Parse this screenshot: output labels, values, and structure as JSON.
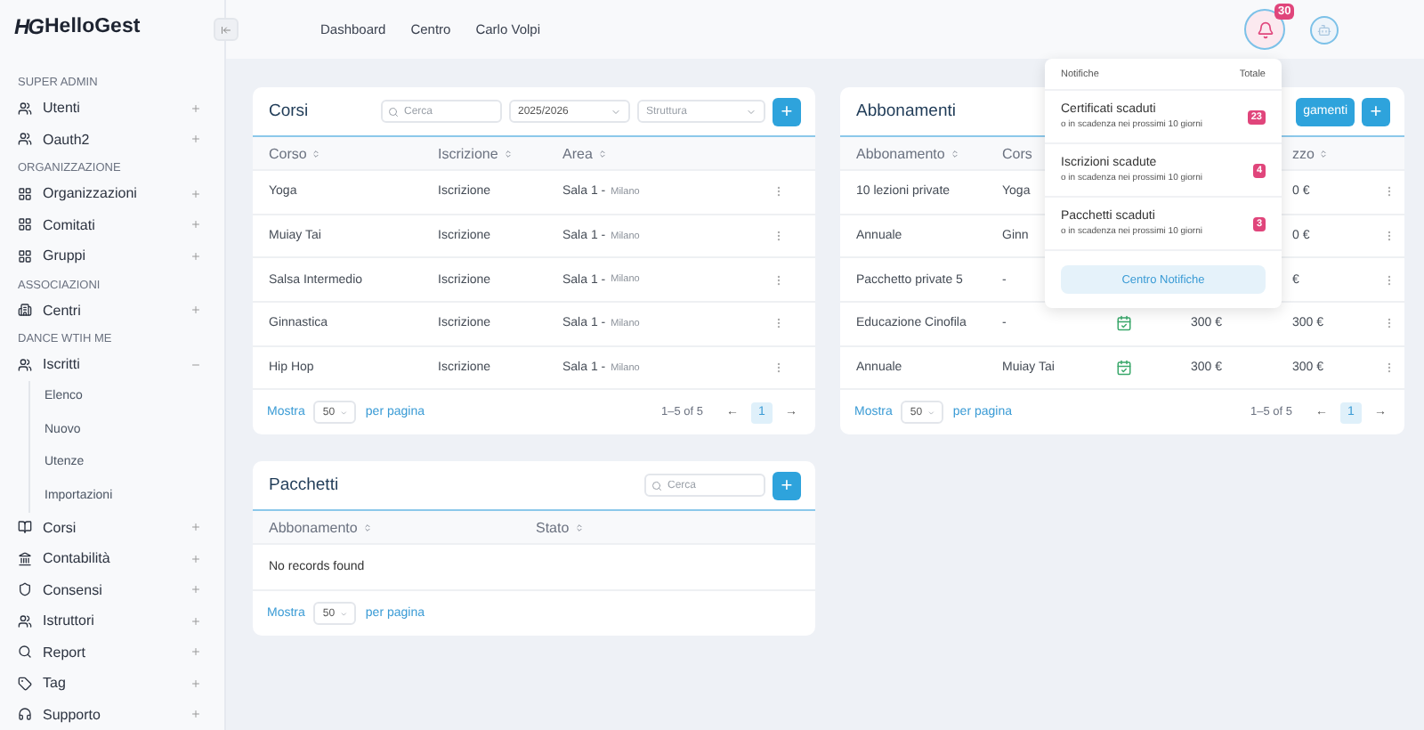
{
  "logo": {
    "mark": "HG",
    "name": "HelloGest"
  },
  "sidebar": {
    "sections": [
      {
        "title": "SUPER ADMIN",
        "items": [
          {
            "label": "Utenti",
            "expanded": false
          },
          {
            "label": "Oauth2",
            "expanded": false
          }
        ]
      },
      {
        "title": "ORGANIZZAZIONE",
        "items": [
          {
            "label": "Organizzazioni",
            "expanded": false
          },
          {
            "label": "Comitati",
            "expanded": false
          },
          {
            "label": "Gruppi",
            "expanded": false
          }
        ]
      },
      {
        "title": "ASSOCIAZIONI",
        "items": [
          {
            "label": "Centri",
            "expanded": false
          }
        ]
      },
      {
        "title": "DANCE WTIH ME",
        "items": [
          {
            "label": "Iscritti",
            "expanded": true,
            "children": [
              {
                "label": "Elenco"
              },
              {
                "label": "Nuovo"
              },
              {
                "label": "Utenze"
              },
              {
                "label": "Importazioni"
              }
            ]
          },
          {
            "label": "Corsi",
            "expanded": false
          },
          {
            "label": "Contabilità",
            "expanded": false
          },
          {
            "label": "Consensi",
            "expanded": false
          },
          {
            "label": "Istruttori",
            "expanded": false
          },
          {
            "label": "Report",
            "expanded": false
          },
          {
            "label": "Tag",
            "expanded": false
          },
          {
            "label": "Supporto",
            "expanded": false
          }
        ]
      }
    ]
  },
  "topbar": {
    "breadcrumbs": [
      "Dashboard",
      "Centro",
      "Carlo Volpi"
    ],
    "notification_count": "30"
  },
  "notifications": {
    "header": "Notifiche",
    "total_label": "Totale",
    "items": [
      {
        "title": "Certificati scaduti",
        "subtitle": "o in scadenza nei prossimi 10 giorni",
        "count": "23"
      },
      {
        "title": "Iscrizioni scadute",
        "subtitle": "o in scadenza nei prossimi 10 giorni",
        "count": "4"
      },
      {
        "title": "Pacchetti scaduti",
        "subtitle": "o in scadenza nei prossimi 10 giorni",
        "count": "3"
      }
    ],
    "button": "Centro Notifiche"
  },
  "corsi": {
    "title": "Corsi",
    "search": {
      "placeholder": "Cerca"
    },
    "year": {
      "value": "2025/2026"
    },
    "structure": {
      "placeholder": "Struttura"
    },
    "add": "+",
    "columns": [
      "Corso",
      "Iscrizione",
      "Area"
    ],
    "rows": [
      {
        "corso": "Yoga",
        "iscrizione": "Iscrizione",
        "area": "Sala 1 -",
        "place": "Milano"
      },
      {
        "corso": "Muiay Tai",
        "iscrizione": "Iscrizione",
        "area": "Sala 1 -",
        "place": "Milano"
      },
      {
        "corso": "Salsa Intermedio",
        "iscrizione": "Iscrizione",
        "area": "Sala 1 -",
        "place": "Milano"
      },
      {
        "corso": "Ginnastica",
        "iscrizione": "Iscrizione",
        "area": "Sala 1 -",
        "place": "Milano"
      },
      {
        "corso": "Hip Hop",
        "iscrizione": "Iscrizione",
        "area": "Sala 1 -",
        "place": "Milano"
      }
    ],
    "footer": {
      "show": "Mostra",
      "per_page": "50",
      "per_page_label": "per pagina",
      "range": "1–5 of 5",
      "prev": "←",
      "next": "→",
      "pages": [
        {
          "label": "1",
          "selected": true
        }
      ]
    }
  },
  "abbonamenti": {
    "title": "Abbonamenti",
    "action": "gamenti",
    "add": "+",
    "columns": [
      "Abbonamento",
      "Cors",
      "zzo"
    ],
    "rows": [
      {
        "covered": true,
        "cells": [
          "10 lezioni private",
          "Yoga",
          "0 €"
        ]
      },
      {
        "covered": true,
        "cells": [
          "Annuale",
          "Ginn",
          "0 €"
        ]
      },
      {
        "covered": true,
        "cells": [
          "Pacchetto private 5",
          "-",
          "€"
        ]
      },
      {
        "covered": false,
        "cells": [
          "Educazione Cinofila",
          "-",
          "300 €",
          "300 €"
        ]
      },
      {
        "covered": false,
        "cells": [
          "Annuale",
          "Muiay Tai",
          "300 €",
          "300 €"
        ]
      }
    ],
    "footer": {
      "show": "Mostra",
      "per_page": "50",
      "per_page_label": "per pagina",
      "range": "1–5 of 5",
      "prev": "←",
      "next": "→",
      "pages": [
        {
          "label": "1",
          "selected": true
        }
      ]
    }
  },
  "pacchetti": {
    "title": "Pacchetti",
    "search": {
      "placeholder": "Cerca"
    },
    "add": "+",
    "columns": [
      "Abbonamento",
      "Stato"
    ],
    "empty": "No records found",
    "footer": {
      "show": "Mostra",
      "per_page": "50",
      "per_page_label": "per pagina"
    }
  }
}
